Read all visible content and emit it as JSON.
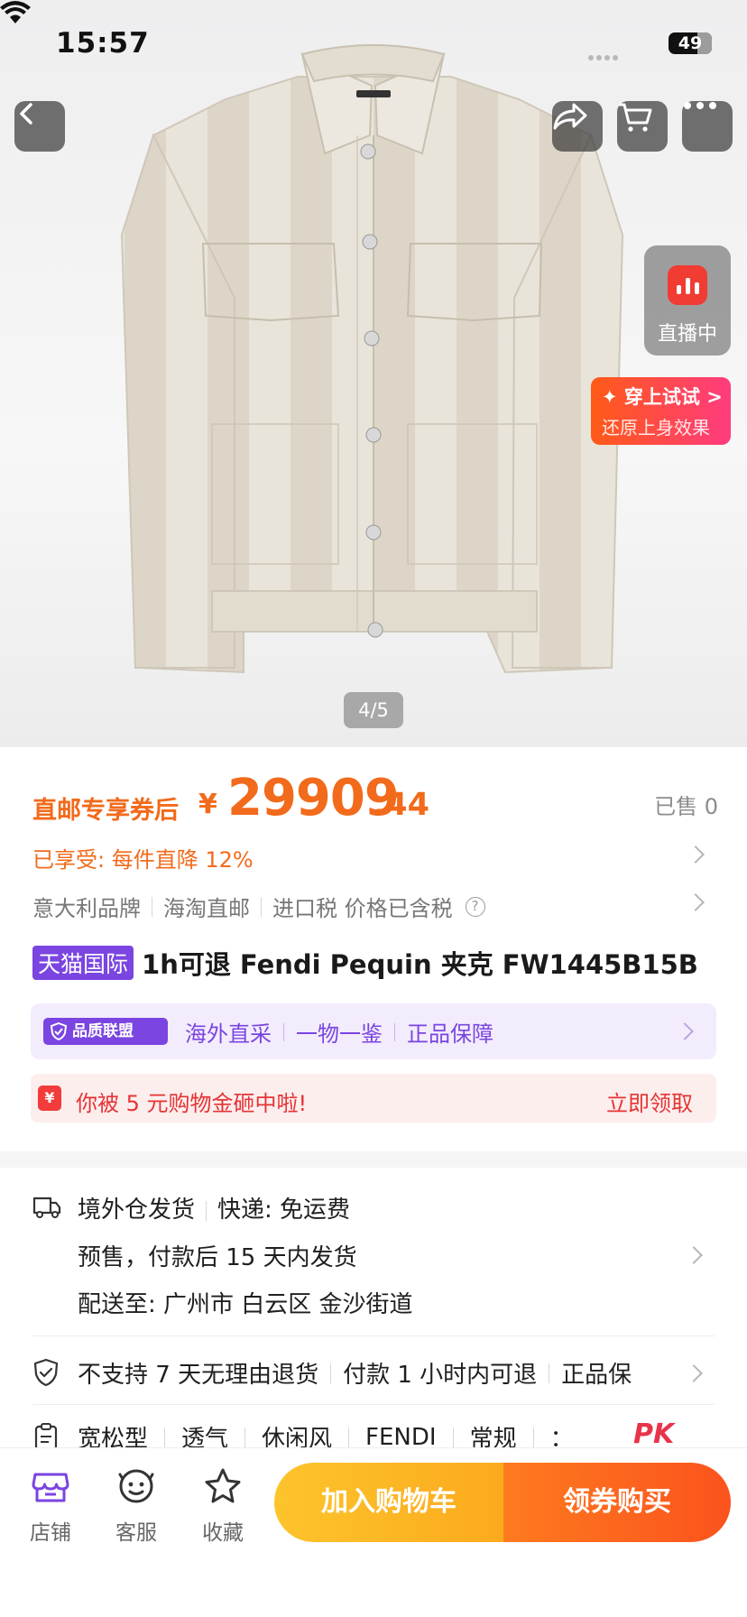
{
  "status": {
    "time": "15:57",
    "battery": "49"
  },
  "hero": {
    "pager": "4/5",
    "live_label": "直播中",
    "tryon_title": "✦ 穿上试试 >",
    "tryon_sub": "还原上身效果"
  },
  "price": {
    "prefix": "直邮专享券后",
    "currency": "¥",
    "integer": "29909",
    "decimal": ".44",
    "sold": "已售 0",
    "discount": "已享受:  每件直降 12%",
    "color": "#f26a1b"
  },
  "tags": [
    "意大利品牌",
    "海淘直邮",
    "进口税 价格已含税"
  ],
  "title": {
    "badge": "天猫国际",
    "text": "1h可退 Fendi Pequin 夹克 FW1445B15B"
  },
  "quality": {
    "badge": "品质联盟",
    "items": [
      "海外直采",
      "一物一鉴",
      "正品保障"
    ],
    "accent": "#7a45e0"
  },
  "coupon": {
    "icon": "¥",
    "text": "你被 5 元购物金砸中啦!",
    "action": "立即领取"
  },
  "shipping": {
    "origin": "境外仓发货",
    "express": "快递:  免运费",
    "presale": "预售，付款后 15 天内发货",
    "destination": "配送至: 广州市  白云区  金沙街道"
  },
  "guarantees": [
    "不支持 7 天无理由退货",
    "付款 1 小时内可退",
    "正品保"
  ],
  "attributes": [
    "宽松型",
    "透气",
    "休闲风",
    "FENDI",
    "常规",
    "："
  ],
  "pk_label": "PK",
  "bottom": {
    "shop": "店铺",
    "service": "客服",
    "favorite": "收藏",
    "add_to_cart": "加入购物车",
    "buy": "领券购买"
  },
  "icons": [
    "back-icon",
    "share-icon",
    "cart-icon",
    "more-icon",
    "live-icon",
    "truck-icon",
    "shield-check-icon",
    "clipboard-icon",
    "shop-icon",
    "service-icon",
    "star-icon",
    "chevron-right-icon",
    "help-icon"
  ]
}
